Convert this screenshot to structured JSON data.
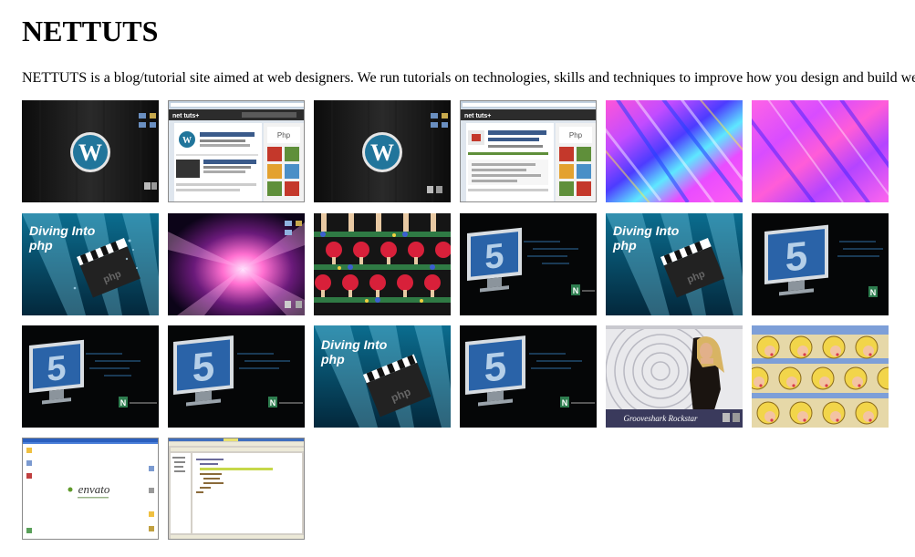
{
  "header": {
    "title": "NETTUTS",
    "description": "NETTUTS is a blog/tutorial site aimed at web designers. We run tutorials on technologies, skills and techniques to improve how you design and build websites."
  },
  "gallery": {
    "thumbnails": [
      {
        "kind": "wordpress-desktop"
      },
      {
        "kind": "nettuts-browser-a"
      },
      {
        "kind": "wordpress-desktop"
      },
      {
        "kind": "nettuts-browser-b"
      },
      {
        "kind": "psychedelic-a"
      },
      {
        "kind": "psychedelic-b"
      },
      {
        "kind": "diving-php"
      },
      {
        "kind": "aurora-desktop"
      },
      {
        "kind": "dancers-pattern"
      },
      {
        "kind": "html5-monitor"
      },
      {
        "kind": "diving-php"
      },
      {
        "kind": "html5-monitor-crop"
      },
      {
        "kind": "html5-monitor"
      },
      {
        "kind": "html5-monitor-crop"
      },
      {
        "kind": "diving-php"
      },
      {
        "kind": "html5-monitor"
      },
      {
        "kind": "rockstar-poster"
      },
      {
        "kind": "popart-pattern"
      },
      {
        "kind": "envato-desktop"
      },
      {
        "kind": "code-editor"
      }
    ],
    "diving_text": {
      "line1": "Diving Into",
      "line2": "php"
    },
    "html5_text": {
      "digit": "5",
      "badge": "N"
    },
    "envato_text": "envato",
    "rockstar_caption": "Grooveshark Rockstar",
    "nettuts_logo": "net tuts+"
  },
  "colors": {
    "ocean_top": "#0b6d8f",
    "ocean_bottom": "#03283c",
    "wp_blue": "#21759b",
    "monitor_blue": "#2a63a8",
    "nettuts_green": "#5f8f3a"
  }
}
